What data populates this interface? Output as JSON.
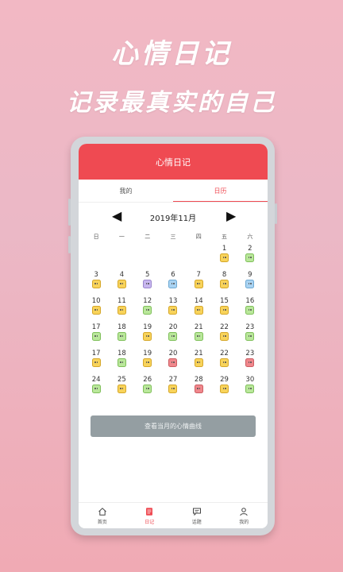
{
  "promo": {
    "title": "心情日记",
    "subtitle": "记录最真实的自己"
  },
  "app": {
    "header_title": "心情日记"
  },
  "tabs": [
    {
      "label": "我的",
      "active": false
    },
    {
      "label": "日历",
      "active": true
    }
  ],
  "calendar": {
    "month_label": "2019年11月",
    "prev_symbol": "◀",
    "next_symbol": "▶",
    "weekdays": [
      "日",
      "一",
      "二",
      "三",
      "四",
      "五",
      "六"
    ],
    "weeks": [
      [
        null,
        null,
        null,
        null,
        null,
        {
          "day": "1",
          "mood": "yellow"
        },
        {
          "day": "2",
          "mood": "green"
        }
      ],
      [
        {
          "day": "3",
          "mood": "yellow"
        },
        {
          "day": "4",
          "mood": "yellow"
        },
        {
          "day": "5",
          "mood": "purple"
        },
        {
          "day": "6",
          "mood": "blue"
        },
        {
          "day": "7",
          "mood": "yellow"
        },
        {
          "day": "8",
          "mood": "yellow"
        },
        {
          "day": "9",
          "mood": "blue"
        }
      ],
      [
        {
          "day": "10",
          "mood": "yellow"
        },
        {
          "day": "11",
          "mood": "yellow"
        },
        {
          "day": "12",
          "mood": "green"
        },
        {
          "day": "13",
          "mood": "yellow"
        },
        {
          "day": "14",
          "mood": "yellow"
        },
        {
          "day": "15",
          "mood": "yellow"
        },
        {
          "day": "16",
          "mood": "green"
        }
      ],
      [
        {
          "day": "17",
          "mood": "green"
        },
        {
          "day": "18",
          "mood": "green"
        },
        {
          "day": "19",
          "mood": "yellow"
        },
        {
          "day": "20",
          "mood": "green"
        },
        {
          "day": "21",
          "mood": "green"
        },
        {
          "day": "22",
          "mood": "yellow"
        },
        {
          "day": "23",
          "mood": "green"
        }
      ],
      [
        {
          "day": "17",
          "mood": "yellow"
        },
        {
          "day": "18",
          "mood": "green"
        },
        {
          "day": "19",
          "mood": "yellow"
        },
        {
          "day": "20",
          "mood": "red"
        },
        {
          "day": "21",
          "mood": "yellow"
        },
        {
          "day": "22",
          "mood": "yellow"
        },
        {
          "day": "23",
          "mood": "red"
        }
      ],
      [
        {
          "day": "24",
          "mood": "green"
        },
        {
          "day": "25",
          "mood": "yellow"
        },
        {
          "day": "26",
          "mood": "green"
        },
        {
          "day": "27",
          "mood": "yellow"
        },
        {
          "day": "28",
          "mood": "red"
        },
        {
          "day": "29",
          "mood": "yellow"
        },
        {
          "day": "30",
          "mood": "green"
        }
      ]
    ]
  },
  "curve_button": "查看当月的心情曲线",
  "bottom_nav": [
    {
      "label": "首页",
      "icon": "home-icon",
      "active": false
    },
    {
      "label": "日记",
      "icon": "diary-icon",
      "active": true
    },
    {
      "label": "话题",
      "icon": "chat-icon",
      "active": false
    },
    {
      "label": "我的",
      "icon": "user-icon",
      "active": false
    }
  ],
  "colors": {
    "accent": "#ef4a52",
    "background_top": "#f2b8c4",
    "background_bottom": "#f0aab4"
  }
}
